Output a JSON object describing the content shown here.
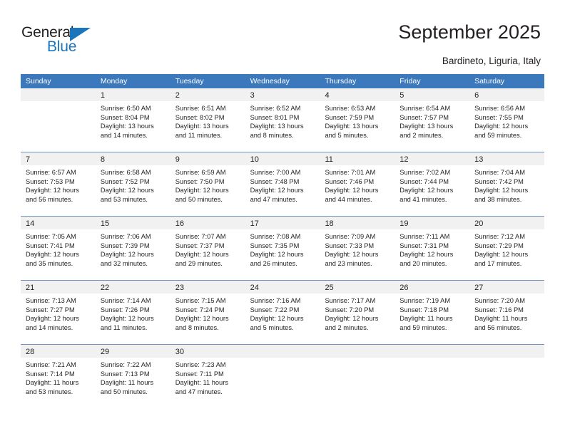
{
  "brand": {
    "word_general": "General",
    "word_blue": "Blue",
    "accent_color": "#1b75bb"
  },
  "header": {
    "title": "September 2025",
    "subtitle": "Bardineto, Liguria, Italy",
    "header_bg_color": "#3c78bc",
    "day_band_color": "#f1f1f1"
  },
  "weekdays": [
    "Sunday",
    "Monday",
    "Tuesday",
    "Wednesday",
    "Thursday",
    "Friday",
    "Saturday"
  ],
  "labels": {
    "sunrise_prefix": "Sunrise:",
    "sunset_prefix": "Sunset:",
    "daylight_prefix": "Daylight:"
  },
  "weeks": [
    {
      "days": [
        {
          "date": "",
          "sunrise": "",
          "sunset": "",
          "daylight_1": "",
          "daylight_2": "",
          "empty": true
        },
        {
          "date": "1",
          "sunrise": "Sunrise: 6:50 AM",
          "sunset": "Sunset: 8:04 PM",
          "daylight_1": "Daylight: 13 hours",
          "daylight_2": "and 14 minutes.",
          "empty": false
        },
        {
          "date": "2",
          "sunrise": "Sunrise: 6:51 AM",
          "sunset": "Sunset: 8:02 PM",
          "daylight_1": "Daylight: 13 hours",
          "daylight_2": "and 11 minutes.",
          "empty": false
        },
        {
          "date": "3",
          "sunrise": "Sunrise: 6:52 AM",
          "sunset": "Sunset: 8:01 PM",
          "daylight_1": "Daylight: 13 hours",
          "daylight_2": "and 8 minutes.",
          "empty": false
        },
        {
          "date": "4",
          "sunrise": "Sunrise: 6:53 AM",
          "sunset": "Sunset: 7:59 PM",
          "daylight_1": "Daylight: 13 hours",
          "daylight_2": "and 5 minutes.",
          "empty": false
        },
        {
          "date": "5",
          "sunrise": "Sunrise: 6:54 AM",
          "sunset": "Sunset: 7:57 PM",
          "daylight_1": "Daylight: 13 hours",
          "daylight_2": "and 2 minutes.",
          "empty": false
        },
        {
          "date": "6",
          "sunrise": "Sunrise: 6:56 AM",
          "sunset": "Sunset: 7:55 PM",
          "daylight_1": "Daylight: 12 hours",
          "daylight_2": "and 59 minutes.",
          "empty": false
        }
      ]
    },
    {
      "days": [
        {
          "date": "7",
          "sunrise": "Sunrise: 6:57 AM",
          "sunset": "Sunset: 7:53 PM",
          "daylight_1": "Daylight: 12 hours",
          "daylight_2": "and 56 minutes.",
          "empty": false
        },
        {
          "date": "8",
          "sunrise": "Sunrise: 6:58 AM",
          "sunset": "Sunset: 7:52 PM",
          "daylight_1": "Daylight: 12 hours",
          "daylight_2": "and 53 minutes.",
          "empty": false
        },
        {
          "date": "9",
          "sunrise": "Sunrise: 6:59 AM",
          "sunset": "Sunset: 7:50 PM",
          "daylight_1": "Daylight: 12 hours",
          "daylight_2": "and 50 minutes.",
          "empty": false
        },
        {
          "date": "10",
          "sunrise": "Sunrise: 7:00 AM",
          "sunset": "Sunset: 7:48 PM",
          "daylight_1": "Daylight: 12 hours",
          "daylight_2": "and 47 minutes.",
          "empty": false
        },
        {
          "date": "11",
          "sunrise": "Sunrise: 7:01 AM",
          "sunset": "Sunset: 7:46 PM",
          "daylight_1": "Daylight: 12 hours",
          "daylight_2": "and 44 minutes.",
          "empty": false
        },
        {
          "date": "12",
          "sunrise": "Sunrise: 7:02 AM",
          "sunset": "Sunset: 7:44 PM",
          "daylight_1": "Daylight: 12 hours",
          "daylight_2": "and 41 minutes.",
          "empty": false
        },
        {
          "date": "13",
          "sunrise": "Sunrise: 7:04 AM",
          "sunset": "Sunset: 7:42 PM",
          "daylight_1": "Daylight: 12 hours",
          "daylight_2": "and 38 minutes.",
          "empty": false
        }
      ]
    },
    {
      "days": [
        {
          "date": "14",
          "sunrise": "Sunrise: 7:05 AM",
          "sunset": "Sunset: 7:41 PM",
          "daylight_1": "Daylight: 12 hours",
          "daylight_2": "and 35 minutes.",
          "empty": false
        },
        {
          "date": "15",
          "sunrise": "Sunrise: 7:06 AM",
          "sunset": "Sunset: 7:39 PM",
          "daylight_1": "Daylight: 12 hours",
          "daylight_2": "and 32 minutes.",
          "empty": false
        },
        {
          "date": "16",
          "sunrise": "Sunrise: 7:07 AM",
          "sunset": "Sunset: 7:37 PM",
          "daylight_1": "Daylight: 12 hours",
          "daylight_2": "and 29 minutes.",
          "empty": false
        },
        {
          "date": "17",
          "sunrise": "Sunrise: 7:08 AM",
          "sunset": "Sunset: 7:35 PM",
          "daylight_1": "Daylight: 12 hours",
          "daylight_2": "and 26 minutes.",
          "empty": false
        },
        {
          "date": "18",
          "sunrise": "Sunrise: 7:09 AM",
          "sunset": "Sunset: 7:33 PM",
          "daylight_1": "Daylight: 12 hours",
          "daylight_2": "and 23 minutes.",
          "empty": false
        },
        {
          "date": "19",
          "sunrise": "Sunrise: 7:11 AM",
          "sunset": "Sunset: 7:31 PM",
          "daylight_1": "Daylight: 12 hours",
          "daylight_2": "and 20 minutes.",
          "empty": false
        },
        {
          "date": "20",
          "sunrise": "Sunrise: 7:12 AM",
          "sunset": "Sunset: 7:29 PM",
          "daylight_1": "Daylight: 12 hours",
          "daylight_2": "and 17 minutes.",
          "empty": false
        }
      ]
    },
    {
      "days": [
        {
          "date": "21",
          "sunrise": "Sunrise: 7:13 AM",
          "sunset": "Sunset: 7:27 PM",
          "daylight_1": "Daylight: 12 hours",
          "daylight_2": "and 14 minutes.",
          "empty": false
        },
        {
          "date": "22",
          "sunrise": "Sunrise: 7:14 AM",
          "sunset": "Sunset: 7:26 PM",
          "daylight_1": "Daylight: 12 hours",
          "daylight_2": "and 11 minutes.",
          "empty": false
        },
        {
          "date": "23",
          "sunrise": "Sunrise: 7:15 AM",
          "sunset": "Sunset: 7:24 PM",
          "daylight_1": "Daylight: 12 hours",
          "daylight_2": "and 8 minutes.",
          "empty": false
        },
        {
          "date": "24",
          "sunrise": "Sunrise: 7:16 AM",
          "sunset": "Sunset: 7:22 PM",
          "daylight_1": "Daylight: 12 hours",
          "daylight_2": "and 5 minutes.",
          "empty": false
        },
        {
          "date": "25",
          "sunrise": "Sunrise: 7:17 AM",
          "sunset": "Sunset: 7:20 PM",
          "daylight_1": "Daylight: 12 hours",
          "daylight_2": "and 2 minutes.",
          "empty": false
        },
        {
          "date": "26",
          "sunrise": "Sunrise: 7:19 AM",
          "sunset": "Sunset: 7:18 PM",
          "daylight_1": "Daylight: 11 hours",
          "daylight_2": "and 59 minutes.",
          "empty": false
        },
        {
          "date": "27",
          "sunrise": "Sunrise: 7:20 AM",
          "sunset": "Sunset: 7:16 PM",
          "daylight_1": "Daylight: 11 hours",
          "daylight_2": "and 56 minutes.",
          "empty": false
        }
      ]
    },
    {
      "days": [
        {
          "date": "28",
          "sunrise": "Sunrise: 7:21 AM",
          "sunset": "Sunset: 7:14 PM",
          "daylight_1": "Daylight: 11 hours",
          "daylight_2": "and 53 minutes.",
          "empty": false
        },
        {
          "date": "29",
          "sunrise": "Sunrise: 7:22 AM",
          "sunset": "Sunset: 7:13 PM",
          "daylight_1": "Daylight: 11 hours",
          "daylight_2": "and 50 minutes.",
          "empty": false
        },
        {
          "date": "30",
          "sunrise": "Sunrise: 7:23 AM",
          "sunset": "Sunset: 7:11 PM",
          "daylight_1": "Daylight: 11 hours",
          "daylight_2": "and 47 minutes.",
          "empty": false
        },
        {
          "date": "",
          "sunrise": "",
          "sunset": "",
          "daylight_1": "",
          "daylight_2": "",
          "empty": true
        },
        {
          "date": "",
          "sunrise": "",
          "sunset": "",
          "daylight_1": "",
          "daylight_2": "",
          "empty": true
        },
        {
          "date": "",
          "sunrise": "",
          "sunset": "",
          "daylight_1": "",
          "daylight_2": "",
          "empty": true
        },
        {
          "date": "",
          "sunrise": "",
          "sunset": "",
          "daylight_1": "",
          "daylight_2": "",
          "empty": true
        }
      ]
    }
  ]
}
